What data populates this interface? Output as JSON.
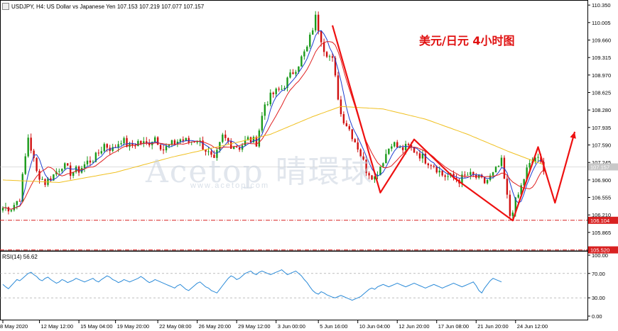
{
  "header": {
    "symbol_line": "USDJPY, H4: US Dollar vs Japanese Yen  107.153 107.219 107.077 107.157"
  },
  "annotation": "美元/日元 4小时图",
  "watermark": {
    "main": "Acetop 晴環球",
    "sub": "www.acetop.com"
  },
  "rsi": {
    "label": "RSI(14) 56.62",
    "levels": [
      70,
      30
    ],
    "tick_labels": [
      "100.00",
      "70.00",
      "30.00",
      "0.00"
    ]
  },
  "colors": {
    "bull": "#1b9a1b",
    "bear": "#d01010",
    "ma_fast": "#1f3fd0",
    "ma_mid": "#e02020",
    "ma_slow": "#f0c020",
    "rsi": "#2a8ad8",
    "arrows": "#ee1111",
    "support": "#d82020"
  },
  "chart_data": {
    "type": "candlestick",
    "ylim": [
      105.5,
      110.45
    ],
    "price_ticks": [
      "110.350",
      "110.005",
      "109.660",
      "109.315",
      "108.970",
      "108.625",
      "108.280",
      "107.935",
      "107.590",
      "107.245",
      "106.900",
      "106.555",
      "106.210",
      "105.865"
    ],
    "current_price": "107.157",
    "support_levels": [
      {
        "label": "106.104",
        "value": 106.104
      },
      {
        "label": "105.520",
        "value": 105.52
      }
    ],
    "time_labels": [
      {
        "label": "8 May 2020",
        "idx": 0
      },
      {
        "label": "12 May 12:00",
        "idx": 13
      },
      {
        "label": "15 May 04:00",
        "idx": 27
      },
      {
        "label": "19 May 20:00",
        "idx": 40
      },
      {
        "label": "22 May 08:00",
        "idx": 55
      },
      {
        "label": "26 May 20:00",
        "idx": 69
      },
      {
        "label": "29 May 12:00",
        "idx": 83
      },
      {
        "label": "3 Jun 00:00",
        "idx": 97
      },
      {
        "label": "5 Jun 16:00",
        "idx": 112
      },
      {
        "label": "10 Jun 04:00",
        "idx": 126
      },
      {
        "label": "12 Jun 20:00",
        "idx": 140
      },
      {
        "label": "17 Jun 08:00",
        "idx": 154
      },
      {
        "label": "21 Jun 20:00",
        "idx": 168
      },
      {
        "label": "24 Jun 12:00",
        "idx": 182
      }
    ],
    "anchors": [
      [
        0,
        106.35
      ],
      [
        3,
        106.35
      ],
      [
        6,
        106.55
      ],
      [
        9,
        107.75
      ],
      [
        12,
        107.05
      ],
      [
        15,
        106.85
      ],
      [
        18,
        107.0
      ],
      [
        21,
        107.2
      ],
      [
        24,
        107.05
      ],
      [
        27,
        107.1
      ],
      [
        30,
        107.25
      ],
      [
        33,
        107.35
      ],
      [
        36,
        107.6
      ],
      [
        39,
        107.5
      ],
      [
        42,
        107.7
      ],
      [
        45,
        107.55
      ],
      [
        48,
        107.65
      ],
      [
        51,
        107.6
      ],
      [
        54,
        107.75
      ],
      [
        57,
        107.5
      ],
      [
        60,
        107.6
      ],
      [
        63,
        107.7
      ],
      [
        66,
        107.65
      ],
      [
        69,
        107.7
      ],
      [
        72,
        107.5
      ],
      [
        75,
        107.25
      ],
      [
        78,
        107.75
      ],
      [
        81,
        107.6
      ],
      [
        84,
        107.55
      ],
      [
        87,
        107.7
      ],
      [
        90,
        107.65
      ],
      [
        93,
        108.4
      ],
      [
        96,
        108.6
      ],
      [
        99,
        108.7
      ],
      [
        102,
        108.95
      ],
      [
        105,
        109.2
      ],
      [
        108,
        109.5
      ],
      [
        111,
        110.1
      ],
      [
        114,
        109.5
      ],
      [
        117,
        109.25
      ],
      [
        120,
        108.2
      ],
      [
        123,
        107.9
      ],
      [
        126,
        107.55
      ],
      [
        129,
        107.1
      ],
      [
        132,
        106.95
      ],
      [
        135,
        107.3
      ],
      [
        138,
        107.65
      ],
      [
        141,
        107.5
      ],
      [
        144,
        107.55
      ],
      [
        147,
        107.45
      ],
      [
        150,
        107.3
      ],
      [
        153,
        107.2
      ],
      [
        156,
        107.0
      ],
      [
        159,
        106.95
      ],
      [
        162,
        106.9
      ],
      [
        165,
        107.0
      ],
      [
        168,
        106.95
      ],
      [
        171,
        106.85
      ],
      [
        174,
        107.0
      ],
      [
        177,
        107.25
      ],
      [
        180,
        106.2
      ],
      [
        183,
        106.6
      ],
      [
        186,
        107.1
      ],
      [
        189,
        107.35
      ],
      [
        192,
        107.15
      ]
    ],
    "ma_slow_anchors": [
      [
        0,
        106.9
      ],
      [
        20,
        106.85
      ],
      [
        40,
        107.05
      ],
      [
        60,
        107.35
      ],
      [
        80,
        107.6
      ],
      [
        95,
        107.8
      ],
      [
        110,
        108.15
      ],
      [
        120,
        108.35
      ],
      [
        135,
        108.3
      ],
      [
        150,
        108.1
      ],
      [
        165,
        107.8
      ],
      [
        180,
        107.45
      ],
      [
        192,
        107.2
      ]
    ],
    "arrow_path": [
      {
        "x": 117,
        "y": 109.95
      },
      {
        "x": 134,
        "y": 106.65
      },
      {
        "x": 146,
        "y": 107.7
      },
      {
        "x": 160,
        "y": 106.95
      },
      {
        "x": 181,
        "y": 106.1
      },
      {
        "x": 190,
        "y": 107.55
      },
      {
        "x": 196,
        "y": 106.45
      },
      {
        "x": 203,
        "y": 107.85
      }
    ],
    "rsi_values": [
      52,
      48,
      45,
      50,
      55,
      60,
      58,
      62,
      66,
      70,
      72,
      68,
      65,
      60,
      58,
      62,
      64,
      60,
      57,
      54,
      56,
      60,
      58,
      55,
      57,
      59,
      62,
      60,
      58,
      56,
      58,
      60,
      62,
      58,
      56,
      60,
      63,
      66,
      64,
      60,
      58,
      55,
      57,
      60,
      58,
      56,
      58,
      60,
      62,
      65,
      62,
      58,
      55,
      57,
      60,
      58,
      56,
      54,
      52,
      50,
      48,
      46,
      50,
      52,
      48,
      44,
      42,
      46,
      50,
      54,
      56,
      52,
      48,
      46,
      42,
      40,
      38,
      44,
      50,
      56,
      62,
      66,
      64,
      60,
      62,
      66,
      70,
      72,
      74,
      70,
      68,
      72,
      74,
      72,
      70,
      68,
      70,
      72,
      74,
      76,
      72,
      68,
      70,
      72,
      74,
      70,
      66,
      60,
      55,
      48,
      42,
      38,
      36,
      40,
      38,
      35,
      33,
      31,
      30,
      32,
      34,
      32,
      30,
      28,
      26,
      28,
      30,
      32,
      36,
      40,
      44,
      46,
      44,
      48,
      50,
      52,
      50,
      48,
      50,
      52,
      54,
      52,
      50,
      48,
      50,
      52,
      54,
      52,
      50,
      48,
      46,
      48,
      50,
      52,
      50,
      48,
      46,
      48,
      50,
      52,
      54,
      52,
      50,
      48,
      50,
      52,
      54,
      56,
      50,
      42,
      38,
      46,
      52,
      58,
      62,
      60,
      58,
      56
    ]
  }
}
